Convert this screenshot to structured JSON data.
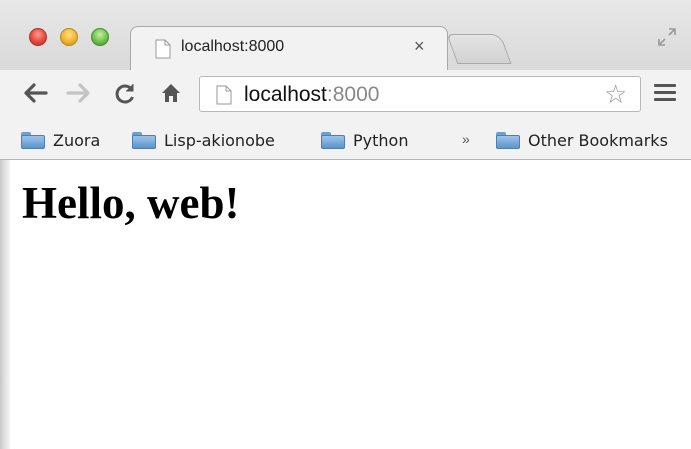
{
  "window": {
    "traffic_lights": [
      "close",
      "minimize",
      "zoom"
    ]
  },
  "tab": {
    "title": "localhost:8000",
    "close_glyph": "×"
  },
  "toolbar": {
    "back_glyph": "←",
    "forward_glyph": "→",
    "reload_glyph": "C",
    "home_glyph": "⌂",
    "url_host": "localhost",
    "url_port": ":8000",
    "star_glyph": "☆"
  },
  "bookmarks": {
    "items": [
      {
        "label": "Zuora"
      },
      {
        "label": "Lisp-akionobe"
      },
      {
        "label": "Python"
      }
    ],
    "overflow_glyph": "»",
    "other_label": "Other Bookmarks"
  },
  "page": {
    "heading": "Hello, web!"
  },
  "colors": {
    "close": "#e8483b",
    "minimize": "#f2b42c",
    "zoom": "#6cc24a",
    "folder": "#5e93c9"
  }
}
